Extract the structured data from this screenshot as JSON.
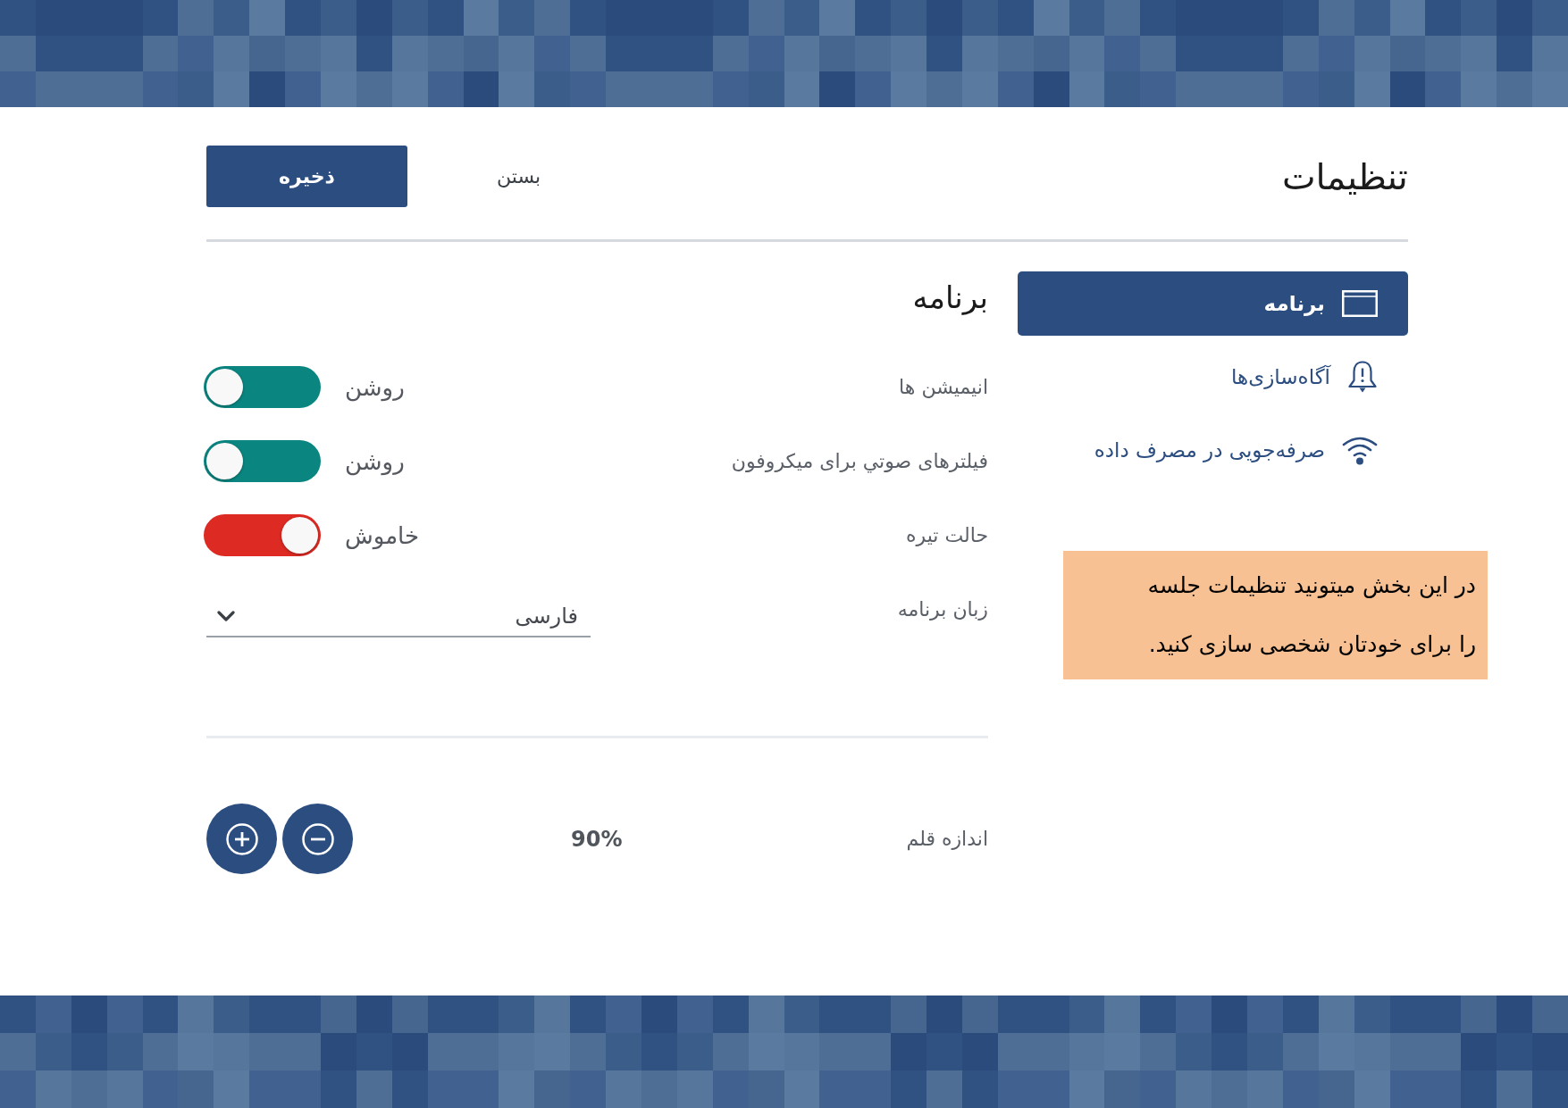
{
  "header": {
    "title": "تنظیمات",
    "buttons": [
      {
        "kind": "close",
        "label": "بستن"
      },
      {
        "kind": "save",
        "label": "ذخیره"
      }
    ]
  },
  "sidebar": {
    "items": [
      {
        "label": "برنامه",
        "selected": true
      },
      {
        "label": "آگاه‌سازی‌ها",
        "selected": false
      },
      {
        "label": "صرفه‌جویی در مصرف داده",
        "selected": false
      }
    ]
  },
  "section": {
    "title": "برنامه",
    "settings": [
      {
        "kind": "toggle",
        "label": "انیمیشن ها",
        "on": true,
        "state_text": "روشن"
      },
      {
        "kind": "toggle",
        "label": "فیلترهای صوتي برای میکروفون",
        "on": true,
        "state_text": "روشن"
      },
      {
        "kind": "toggle",
        "label": "حالت تیره",
        "on": false,
        "state_text": "خاموش"
      },
      {
        "kind": "select",
        "label": "زبان برنامه",
        "value": "فارسی"
      }
    ]
  },
  "font_size": {
    "label": "اندازه قلم",
    "value": "90%"
  },
  "hint": {
    "text": "در این بخش میتونید تنظیمات جلسه\nرا برای خودتان شخصی سازی کنید."
  }
}
